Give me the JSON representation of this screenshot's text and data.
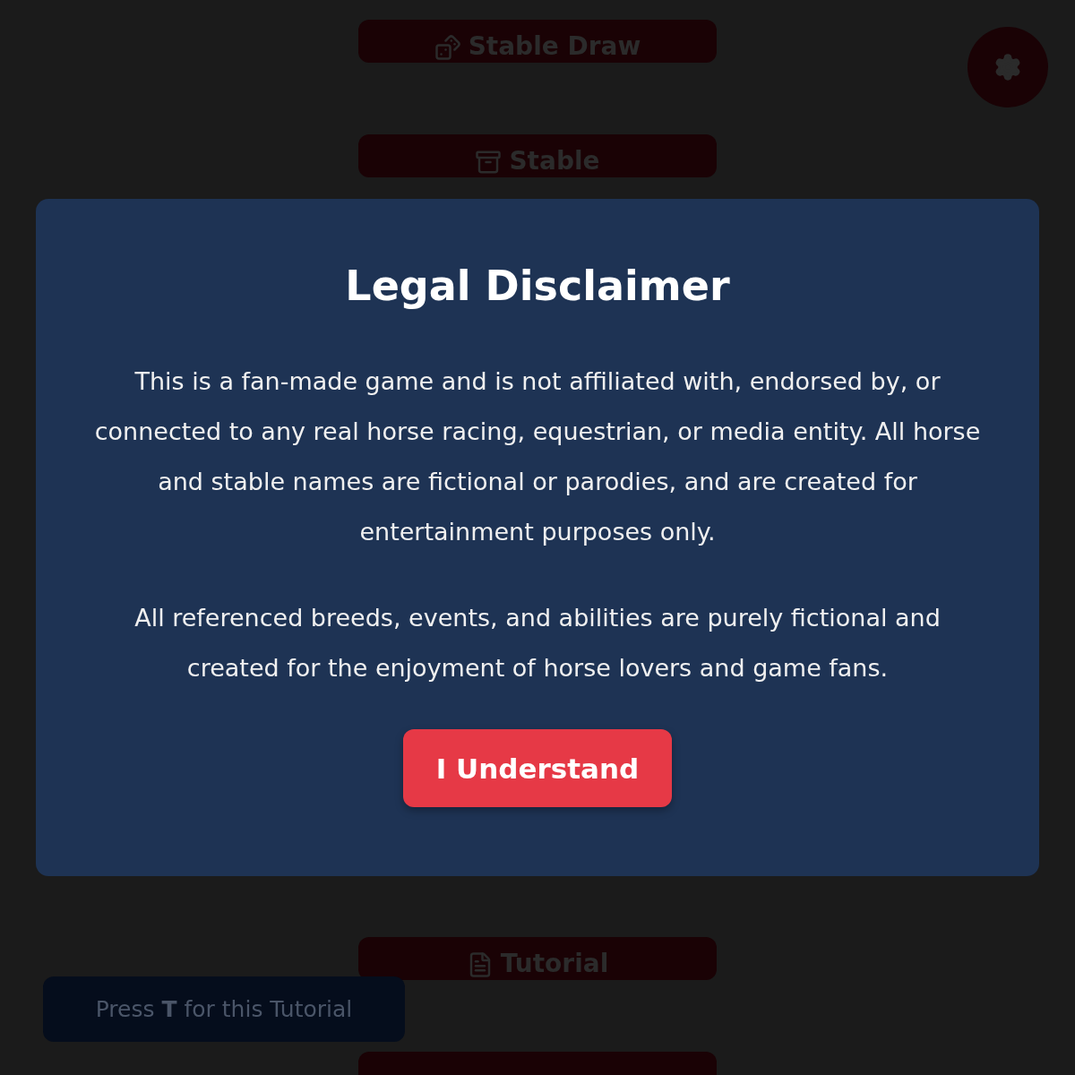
{
  "menu_buttons": [
    {
      "label": "Stable Draw"
    },
    {
      "label": "Stable"
    },
    {
      "label": "Tutorial"
    }
  ],
  "hint": "Press **T** for this Tutorial",
  "dialog": {
    "title": "Legal Disclaimer",
    "paragraphs": [
      "This is a fan-made game and is not affiliated with, endorsed by, or connected to any real horse racing, equestrian, or media entity. All horse and stable names are fictional or parodies, and are created for entertainment purposes only.",
      "All referenced breeds, events, and abilities are purely fictional and created for the enjoyment of horse lovers and game fans."
    ],
    "button": "I Understand"
  }
}
